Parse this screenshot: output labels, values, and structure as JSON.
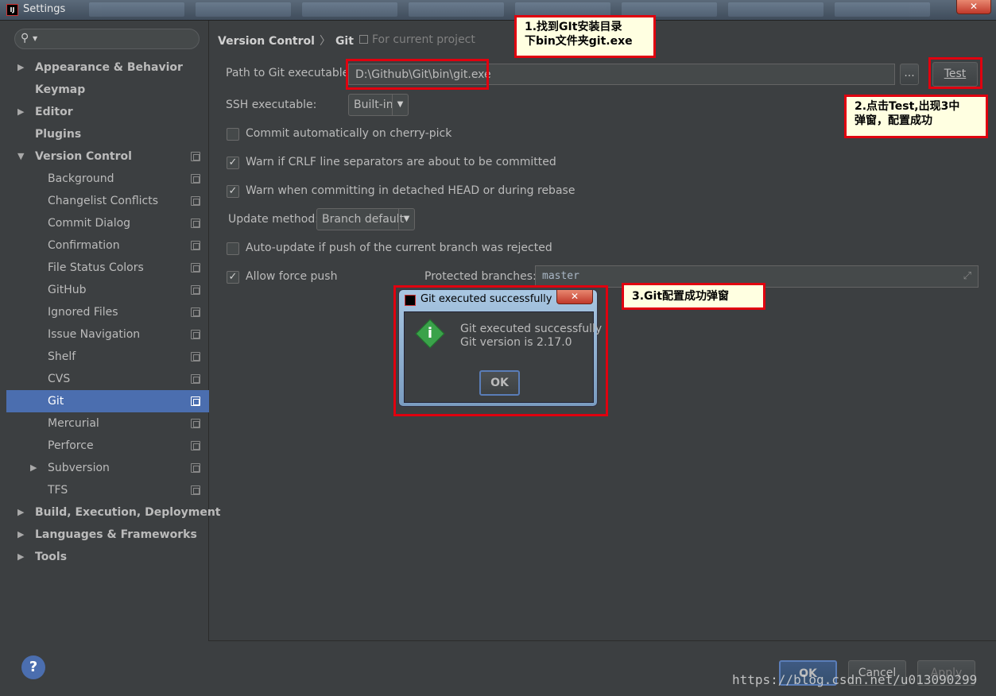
{
  "window": {
    "title": "Settings",
    "close_glyph": "✕"
  },
  "sidebar": {
    "search_glyph": "⚲",
    "items": [
      {
        "label": "Appearance & Behavior",
        "level": "top",
        "arrow": "▶"
      },
      {
        "label": "Keymap",
        "level": "top",
        "arrow": ""
      },
      {
        "label": "Editor",
        "level": "top",
        "arrow": "▶"
      },
      {
        "label": "Plugins",
        "level": "top",
        "arrow": ""
      },
      {
        "label": "Version Control",
        "level": "top",
        "arrow": "▼"
      },
      {
        "label": "Background",
        "level": "child"
      },
      {
        "label": "Changelist Conflicts",
        "level": "child"
      },
      {
        "label": "Commit Dialog",
        "level": "child"
      },
      {
        "label": "Confirmation",
        "level": "child"
      },
      {
        "label": "File Status Colors",
        "level": "child"
      },
      {
        "label": "GitHub",
        "level": "child"
      },
      {
        "label": "Ignored Files",
        "level": "child"
      },
      {
        "label": "Issue Navigation",
        "level": "child"
      },
      {
        "label": "Shelf",
        "level": "child"
      },
      {
        "label": "CVS",
        "level": "child"
      },
      {
        "label": "Git",
        "level": "child",
        "selected": true
      },
      {
        "label": "Mercurial",
        "level": "child"
      },
      {
        "label": "Perforce",
        "level": "child"
      },
      {
        "label": "Subversion",
        "level": "child",
        "arrow": "▶"
      },
      {
        "label": "TFS",
        "level": "child"
      },
      {
        "label": "Build, Execution, Deployment",
        "level": "top",
        "arrow": "▶"
      },
      {
        "label": "Languages & Frameworks",
        "level": "top",
        "arrow": "▶"
      },
      {
        "label": "Tools",
        "level": "top",
        "arrow": "▶"
      }
    ]
  },
  "breadcrumb": {
    "part1": "Version Control",
    "separator": "〉",
    "part2": "Git",
    "scope": "For current project"
  },
  "form": {
    "path_label": "Path to Git executable:",
    "path_value": "D:\\Github\\Git\\bin\\git.exe",
    "browse_label": "...",
    "test_label": "Test",
    "ssh_label": "SSH executable:",
    "ssh_value": "Built-in",
    "commit_cherry_label": "Commit automatically on cherry-pick",
    "commit_cherry_checked": false,
    "crlf_label": "Warn if CRLF line separators are about to be committed",
    "crlf_checked": true,
    "detached_label": "Warn when committing in detached HEAD or during rebase",
    "detached_checked": true,
    "update_method_label": "Update method:",
    "update_method_value": "Branch default",
    "auto_update_label": "Auto-update if push of the current branch was rejected",
    "auto_update_checked": false,
    "force_push_label": "Allow force push",
    "force_push_checked": true,
    "protected_label": "Protected branches:",
    "protected_value": "master",
    "check_glyph": "✓",
    "dropdown_glyph": "▼"
  },
  "annotations": {
    "note1_line1": "1.找到GIt安装目录",
    "note1_line2": "下bin文件夹git.exe",
    "note2_line1": "2.点击Test,出现3中",
    "note2_line2": "弹窗，配置成功",
    "note3": "3.Git配置成功弹窗"
  },
  "dialog": {
    "title": "Git executed successfully",
    "message_line1": "Git executed successfully",
    "message_line2": "Git version is 2.17.0",
    "ok_label": "OK",
    "info_glyph": "i",
    "close_glyph": "✕"
  },
  "footer": {
    "help_glyph": "?",
    "ok_label": "OK",
    "cancel_label": "Cancel",
    "apply_label": "Apply",
    "watermark": "https://blog.csdn.net/u013090299"
  }
}
